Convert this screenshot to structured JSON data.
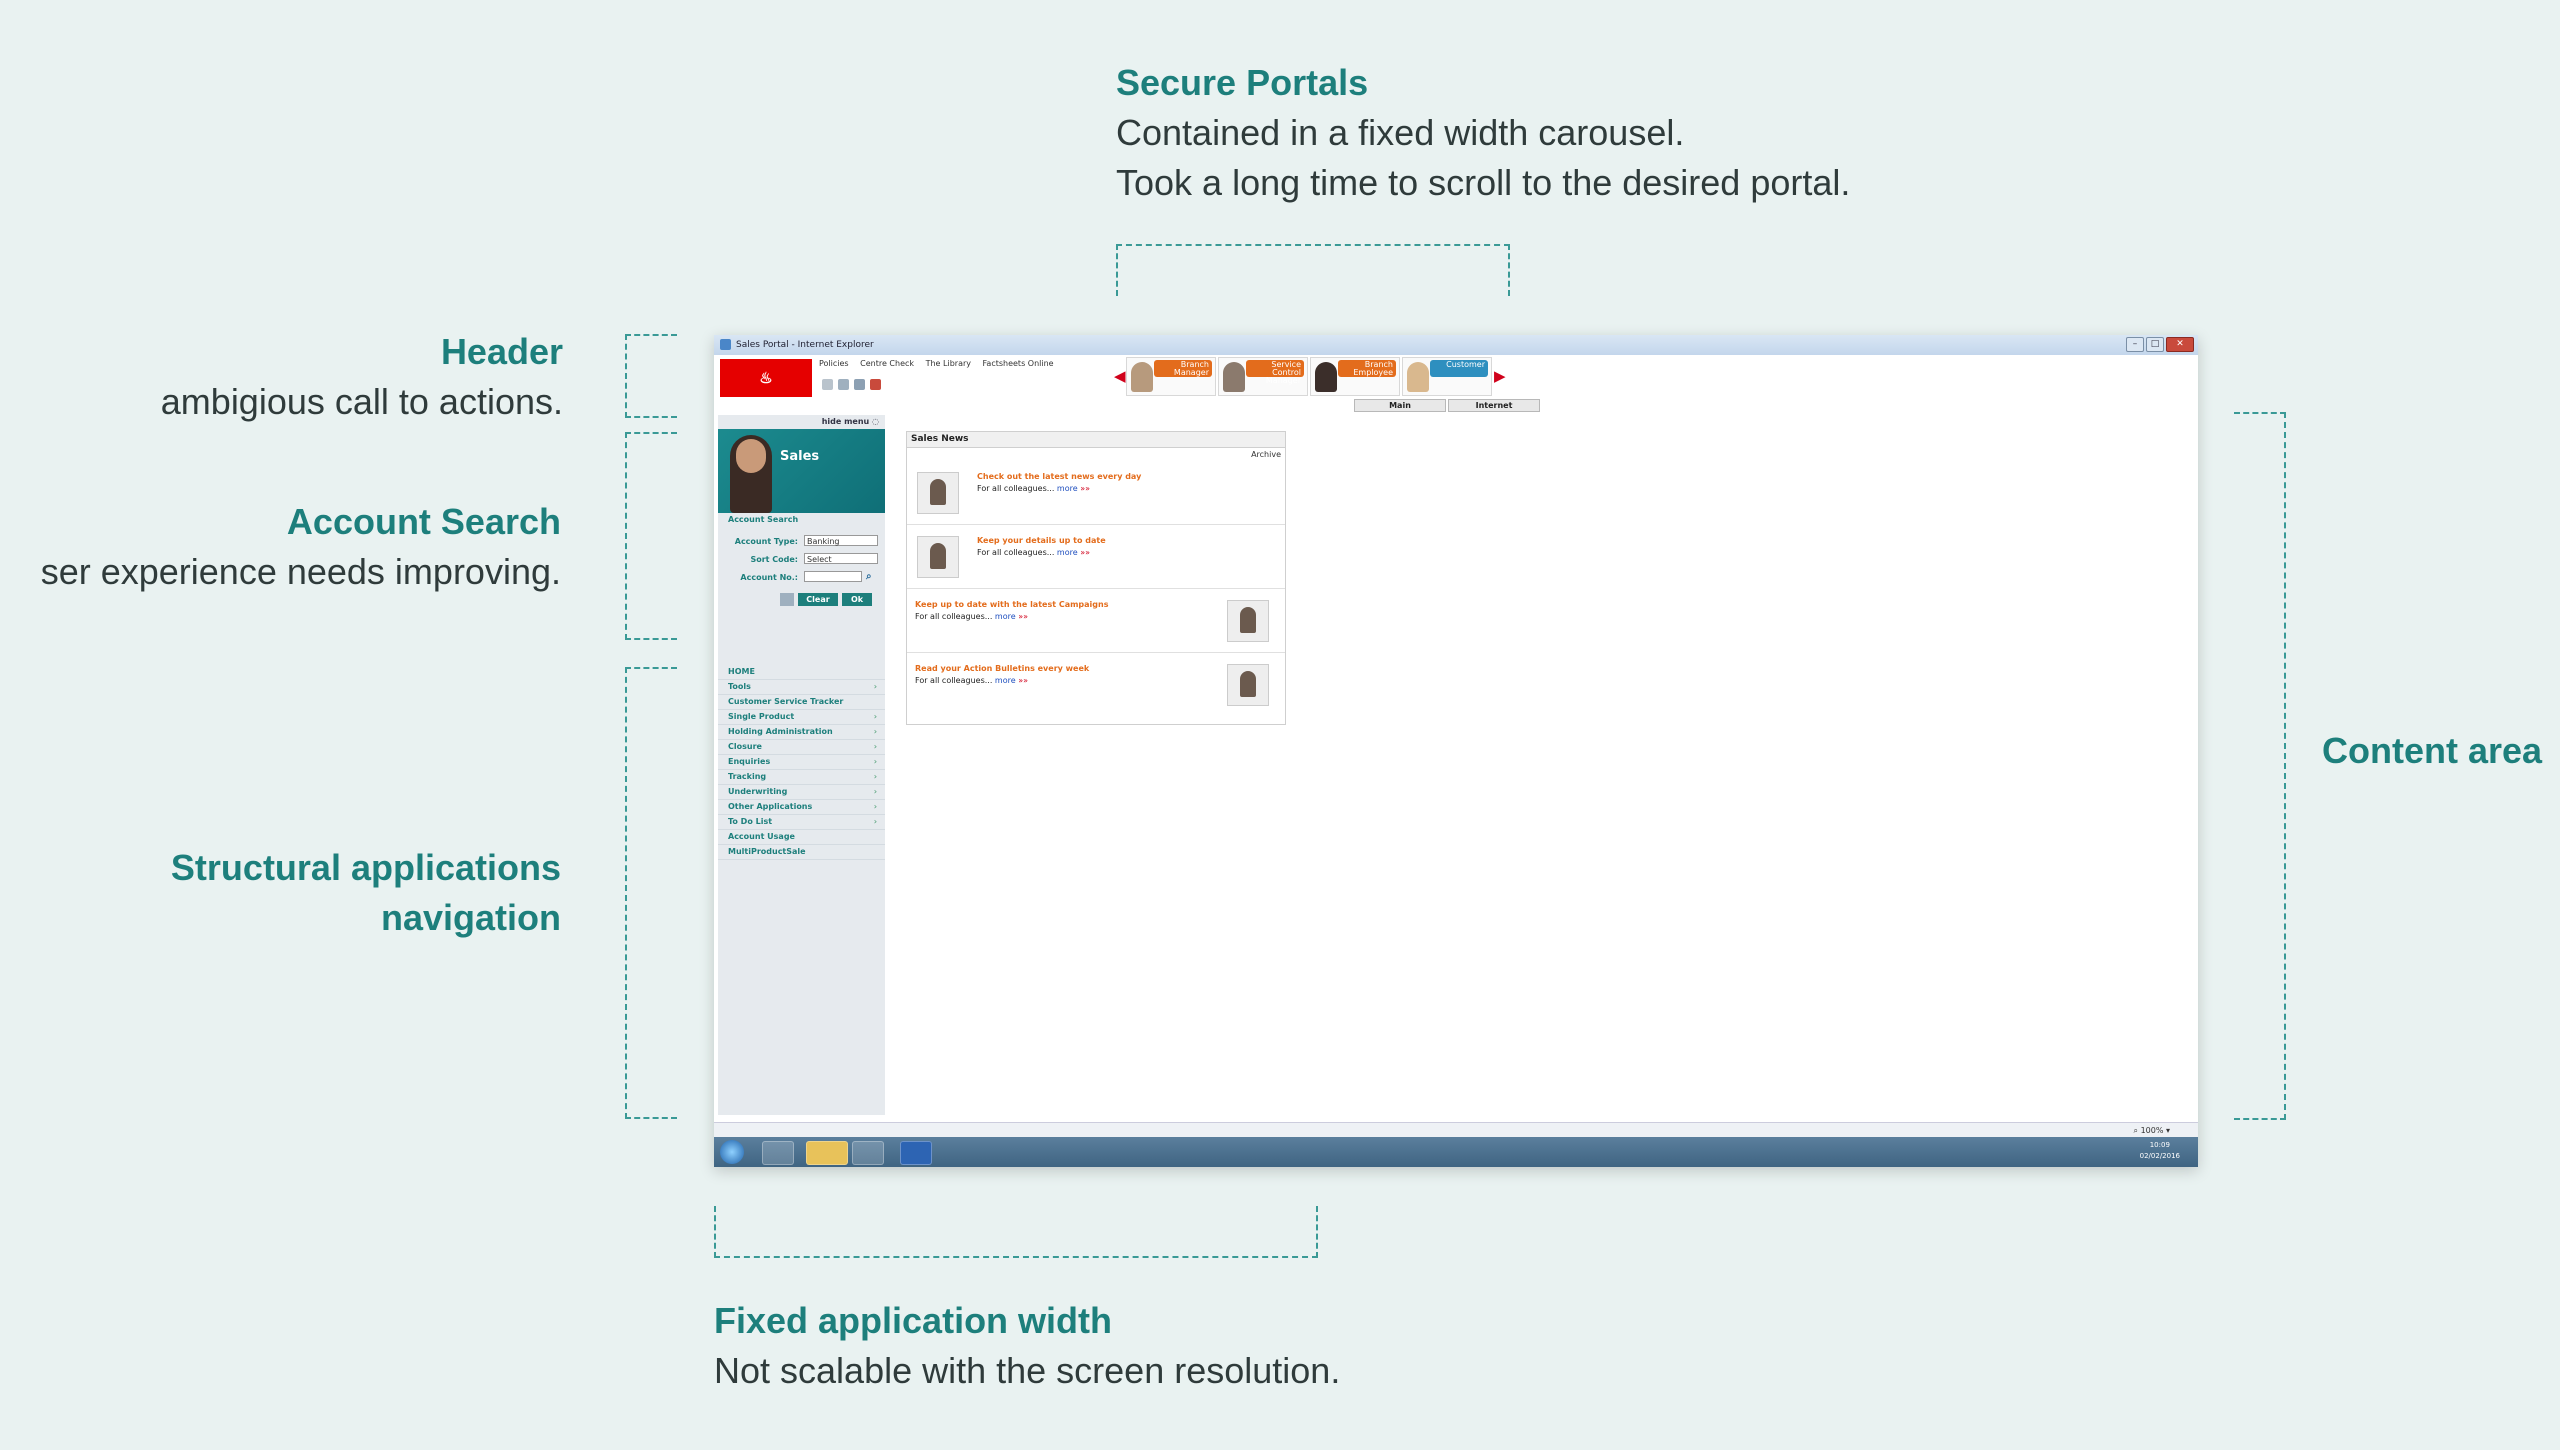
{
  "annotations": {
    "secure_portals": {
      "heading": "Secure Portals",
      "line1": "Contained in a fixed width carousel.",
      "line2": "Took a long time to scroll to the desired portal."
    },
    "header": {
      "heading": "Header",
      "body": "ambigious call to actions."
    },
    "account_search": {
      "heading": "Account Search",
      "body": "ser experience needs improving."
    },
    "structural_nav": {
      "heading_line1": "Structural applications",
      "heading_line2": "navigation"
    },
    "content_area": {
      "heading": "Content area"
    },
    "fixed_width": {
      "heading": "Fixed application width",
      "body": "Not scalable with the screen resolution."
    }
  },
  "window": {
    "title": "Sales Portal - Internet Explorer",
    "logo": "Santander",
    "topnav": [
      "Policies",
      "Centre Check",
      "The Library",
      "Factsheets Online"
    ],
    "portals": [
      {
        "label": "Branch Manager"
      },
      {
        "label": "Service Control Manager"
      },
      {
        "label": "Branch Employee"
      },
      {
        "label": "Customer"
      }
    ],
    "portal_tabs": [
      "Main",
      "Internet"
    ],
    "sidebar": {
      "hide_menu": "hide menu",
      "banner": "Sales",
      "account_search_title": "Account Search",
      "account_type_label": "Account Type:",
      "account_type_value": "Banking",
      "sort_code_label": "Sort Code:",
      "sort_code_value": "Select",
      "account_no_label": "Account No.:",
      "clear_label": "Clear",
      "ok_label": "Ok",
      "nav": [
        "HOME",
        "Tools",
        "Customer Service Tracker",
        "Single Product",
        "Holding Administration",
        "Closure",
        "Enquiries",
        "Tracking",
        "Underwriting",
        "Other Applications",
        "To Do List",
        "Account Usage",
        "MultiProductSale"
      ]
    },
    "news": {
      "title": "Sales News",
      "archive": "Archive",
      "items": [
        {
          "headline": "Check out the latest news every day",
          "body": "For all colleagues...",
          "more": "more",
          "dots": "»»"
        },
        {
          "headline": "Keep your details up to date",
          "body": "For all colleagues...",
          "more": "more",
          "dots": "»»"
        },
        {
          "headline": "Keep up to date with the latest Campaigns",
          "body": "For all colleagues...",
          "more": "more",
          "dots": "»»"
        },
        {
          "headline": "Read your Action Bulletins every week",
          "body": "For all colleagues...",
          "more": "more",
          "dots": "»»"
        }
      ]
    },
    "zoom": "100%",
    "clock_time": "10:09",
    "clock_date": "02/02/2016"
  }
}
